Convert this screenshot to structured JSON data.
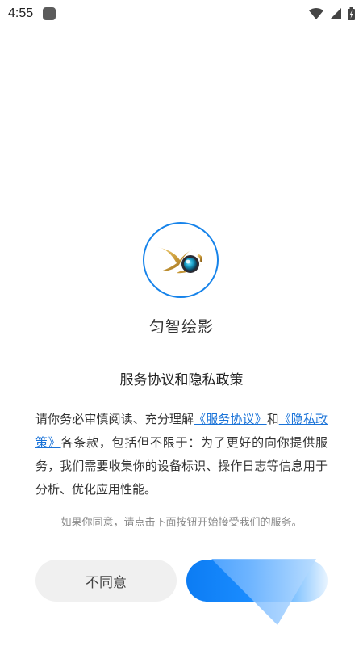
{
  "status_bar": {
    "time": "4:55",
    "icons": [
      "notification-square-icon",
      "wifi-icon",
      "cellular-signal-icon",
      "battery-charging-icon"
    ]
  },
  "app": {
    "logo_icon": "app-logo-icon",
    "name": "匀智绘影"
  },
  "dialog": {
    "title": "服务协议和隐私政策",
    "body": {
      "intro": "请你务必审慎阅读、充分理解",
      "link_service": "《服务协议》",
      "and": "和",
      "link_privacy": "《隐私政策》",
      "rest": "各条款，包括但不限于：为了更好的向你提供服务，我们需要收集你的设备标识、操作日志等信息用于分析、优化应用性能。"
    },
    "hint": "如果你同意，请点击下面按钮开始接受我们的服务。",
    "disagree_label": "不同意",
    "agree_label": ""
  },
  "colors": {
    "accent": "#1683ea",
    "link": "#1a73d8",
    "disagree_bg": "#f0f0f0"
  }
}
